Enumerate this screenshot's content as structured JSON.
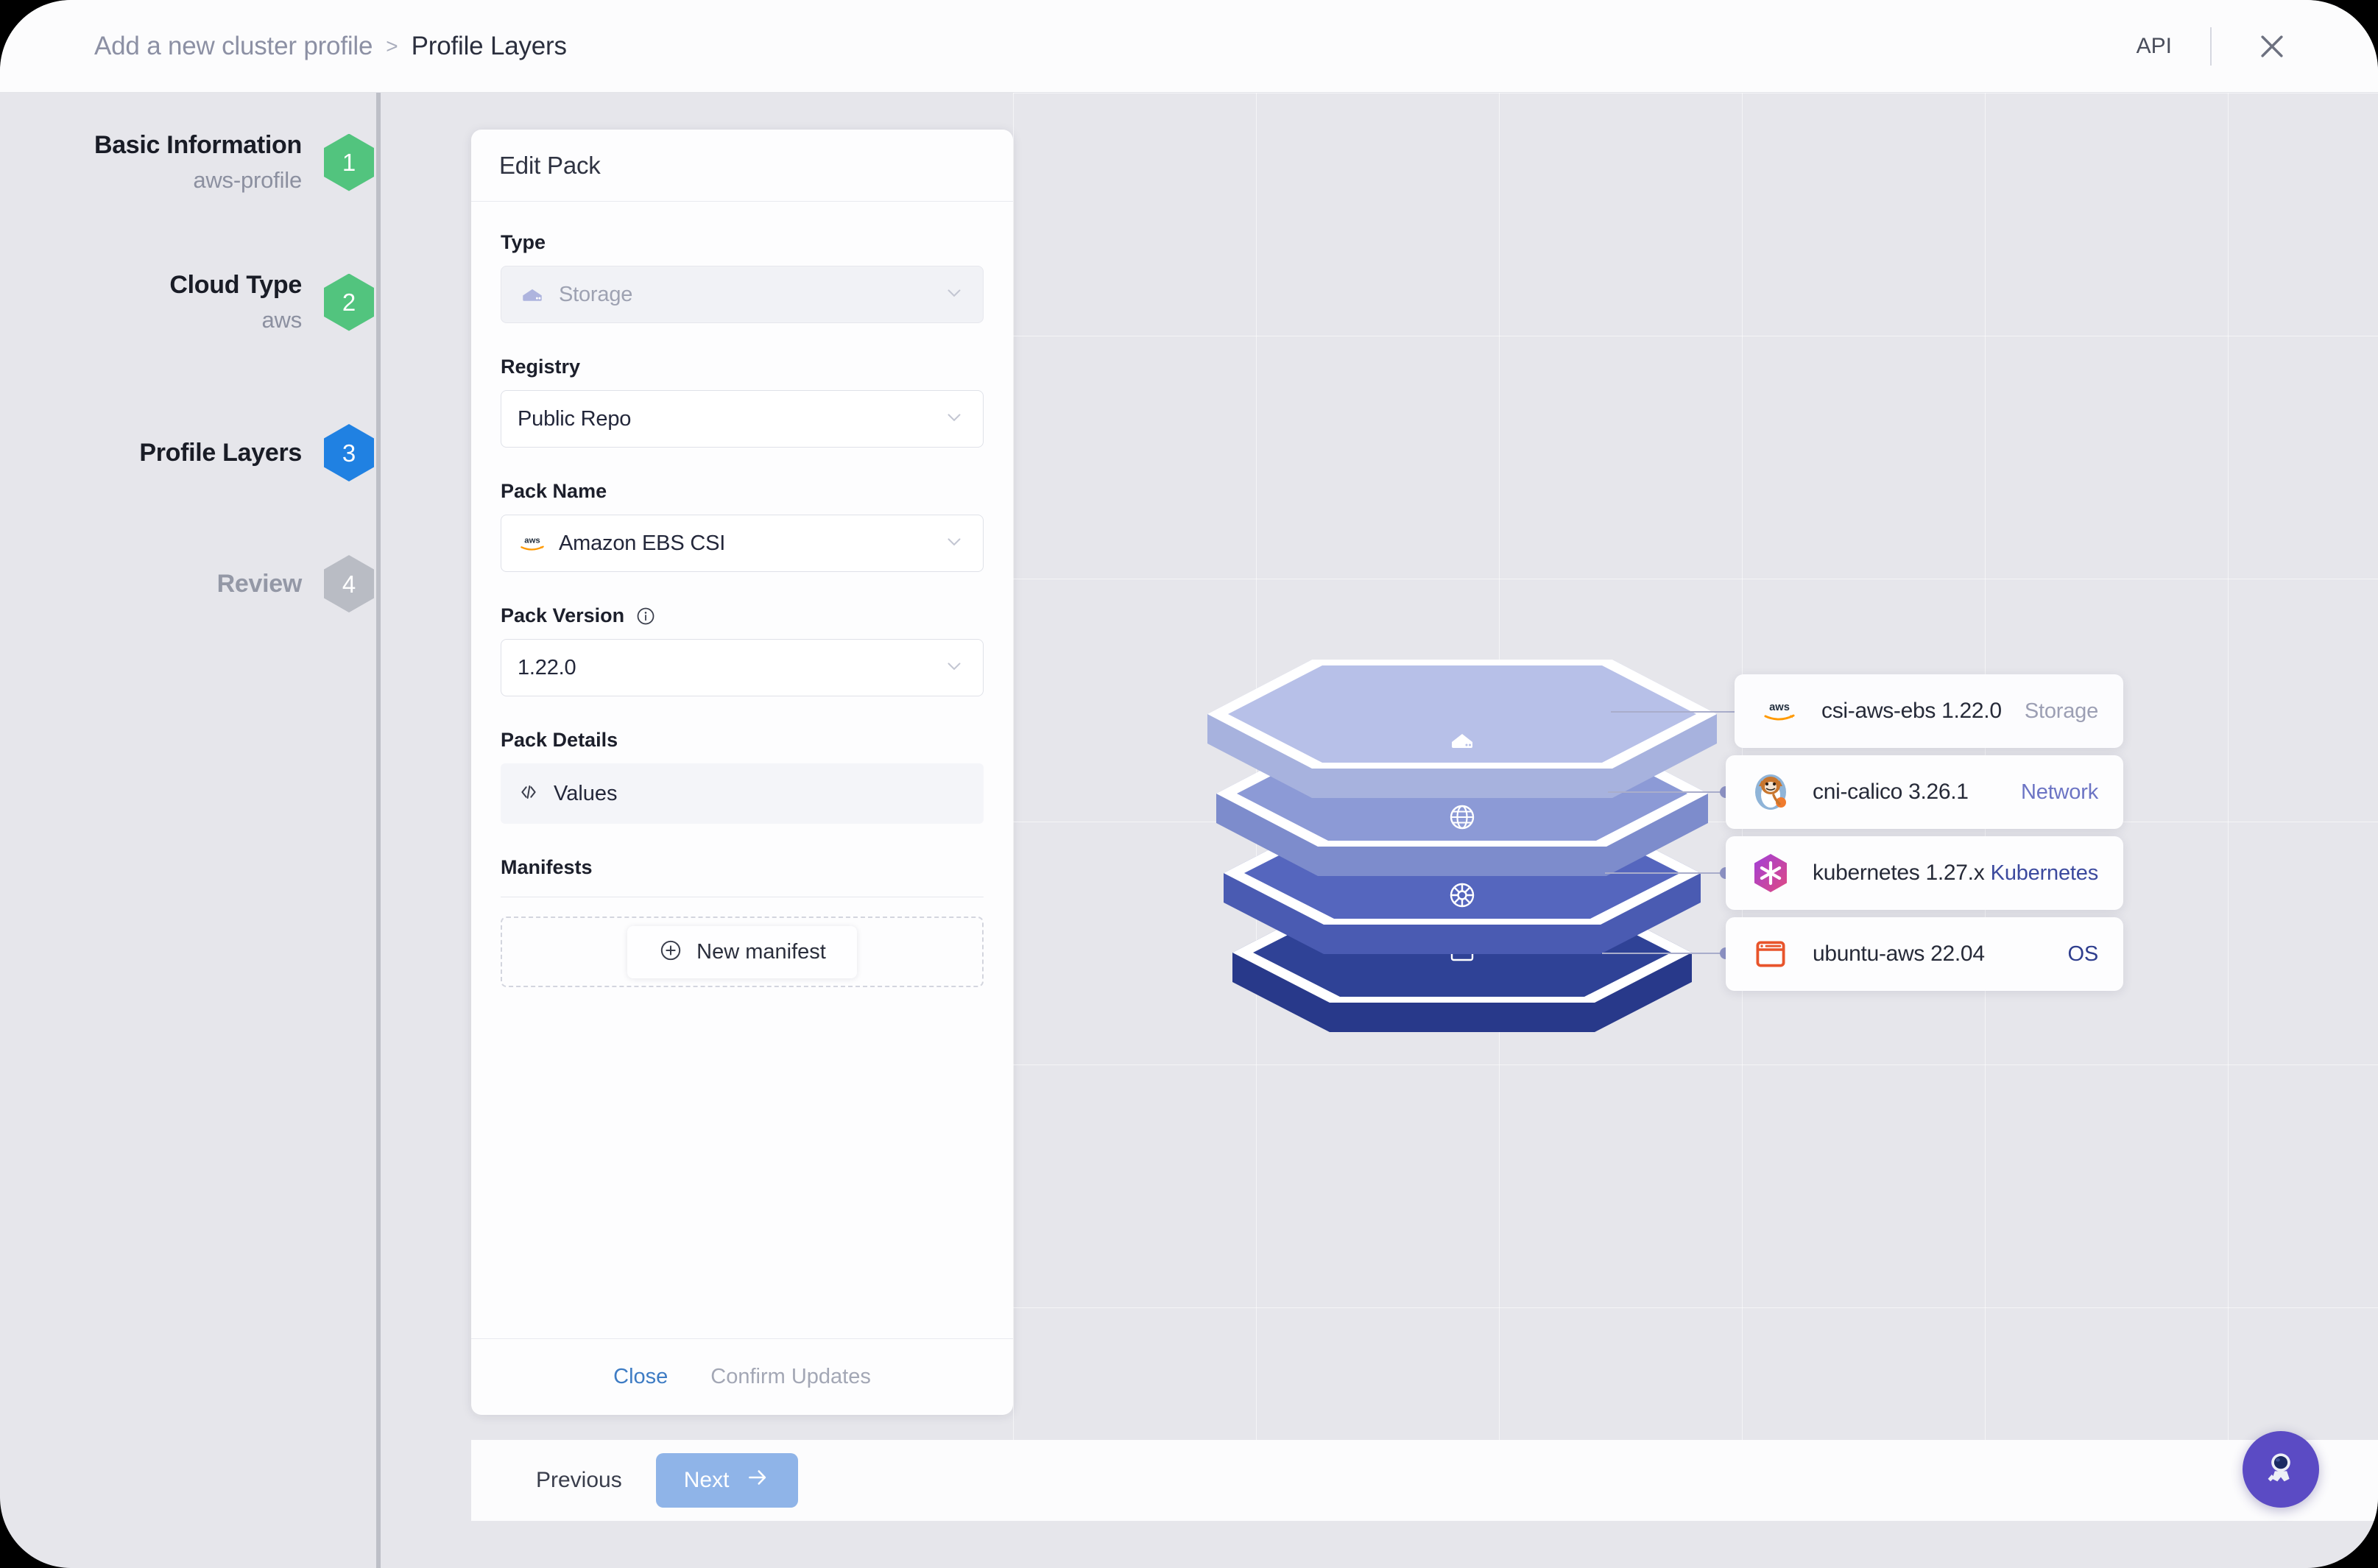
{
  "topbar": {
    "breadcrumb_root": "Add a new cluster profile",
    "breadcrumb_separator": ">",
    "breadcrumb_current": "Profile Layers",
    "api_label": "API",
    "close_icon": "close-icon"
  },
  "stepper": {
    "steps": [
      {
        "number": "1",
        "title": "Basic Information",
        "subtitle": "aws-profile",
        "state": "complete",
        "color": "#52C47E"
      },
      {
        "number": "2",
        "title": "Cloud Type",
        "subtitle": "aws",
        "state": "complete",
        "color": "#52C47E"
      },
      {
        "number": "3",
        "title": "Profile Layers",
        "subtitle": "",
        "state": "active",
        "color": "#2081E2"
      },
      {
        "number": "4",
        "title": "Review",
        "subtitle": "",
        "state": "pending",
        "color": "#B9BCC4"
      }
    ]
  },
  "edit_pack": {
    "title": "Edit Pack",
    "type_label": "Type",
    "type_value": "Storage",
    "type_icon": "storage-icon",
    "registry_label": "Registry",
    "registry_value": "Public Repo",
    "pack_name_label": "Pack Name",
    "pack_name_value": "Amazon EBS CSI",
    "pack_name_icon": "aws-icon",
    "pack_version_label": "Pack Version",
    "pack_version_info_icon": "info-icon",
    "pack_version_value": "1.22.0",
    "pack_details_label": "Pack Details",
    "values_label": "Values",
    "values_icon": "code-icon",
    "manifests_label": "Manifests",
    "new_manifest_label": "New manifest",
    "new_manifest_icon": "plus-circle-icon",
    "close_label": "Close",
    "confirm_label": "Confirm Updates",
    "close_color": "#3E7CC4",
    "confirm_color": "#A3A7B5"
  },
  "layers": {
    "stack": [
      {
        "icon": "storage-icon",
        "top_color": "#B7C0E8",
        "side_color": "#A7B2DE"
      },
      {
        "icon": "globe-icon",
        "top_color": "#8C9AD6",
        "side_color": "#7D8CCC"
      },
      {
        "icon": "helm-icon",
        "top_color": "#5566BE",
        "side_color": "#4A5BB2"
      },
      {
        "icon": "window-icon",
        "top_color": "#2F4296",
        "side_color": "#28398A"
      }
    ],
    "cards": [
      {
        "name": "csi-aws-ebs 1.22.0",
        "type": "Storage",
        "icon": "aws-icon",
        "type_color": "#9C9FB4",
        "selected": true
      },
      {
        "name": "cni-calico 3.26.1",
        "type": "Network",
        "icon": "calico-icon",
        "type_color": "#6C74C4",
        "selected": false
      },
      {
        "name": "kubernetes 1.27.x",
        "type": "Kubernetes",
        "icon": "kubernetes-pack-icon",
        "type_color": "#3C4A9E",
        "selected": false
      },
      {
        "name": "ubuntu-aws 22.04",
        "type": "OS",
        "icon": "ubuntu-icon",
        "type_color": "#2F3E8E",
        "selected": false
      }
    ]
  },
  "bottom_nav": {
    "previous_label": "Previous",
    "next_label": "Next",
    "next_icon": "arrow-right-icon",
    "next_color": "#8FB4E8"
  },
  "fab": {
    "icon": "astronaut-icon",
    "color": "#5B4BC4"
  }
}
